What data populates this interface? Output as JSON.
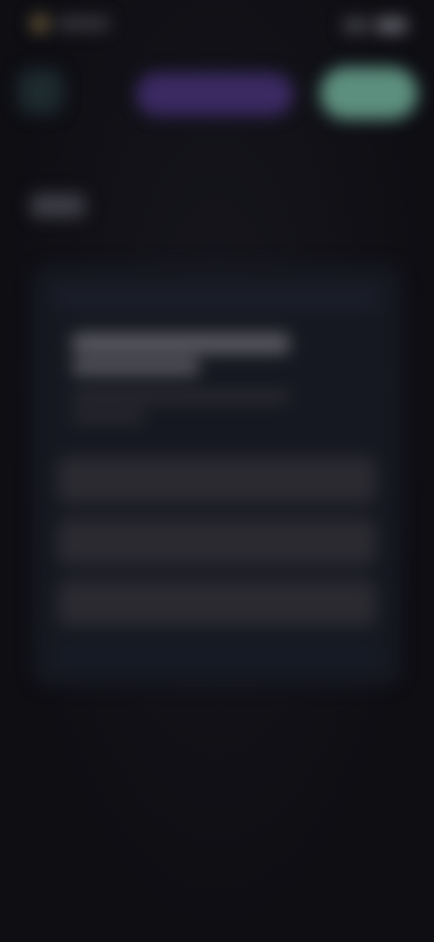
{
  "dialog": {
    "options": [
      "",
      "",
      ""
    ]
  },
  "colors": {
    "background": "#0f0f14",
    "card": "#161821",
    "accent_purple": "#3a2a62",
    "accent_green": "#5d8f7e",
    "option_bg": "#2a2a30"
  },
  "icons": [
    "back-arrow-icon",
    "signal-icon",
    "battery-icon"
  ]
}
